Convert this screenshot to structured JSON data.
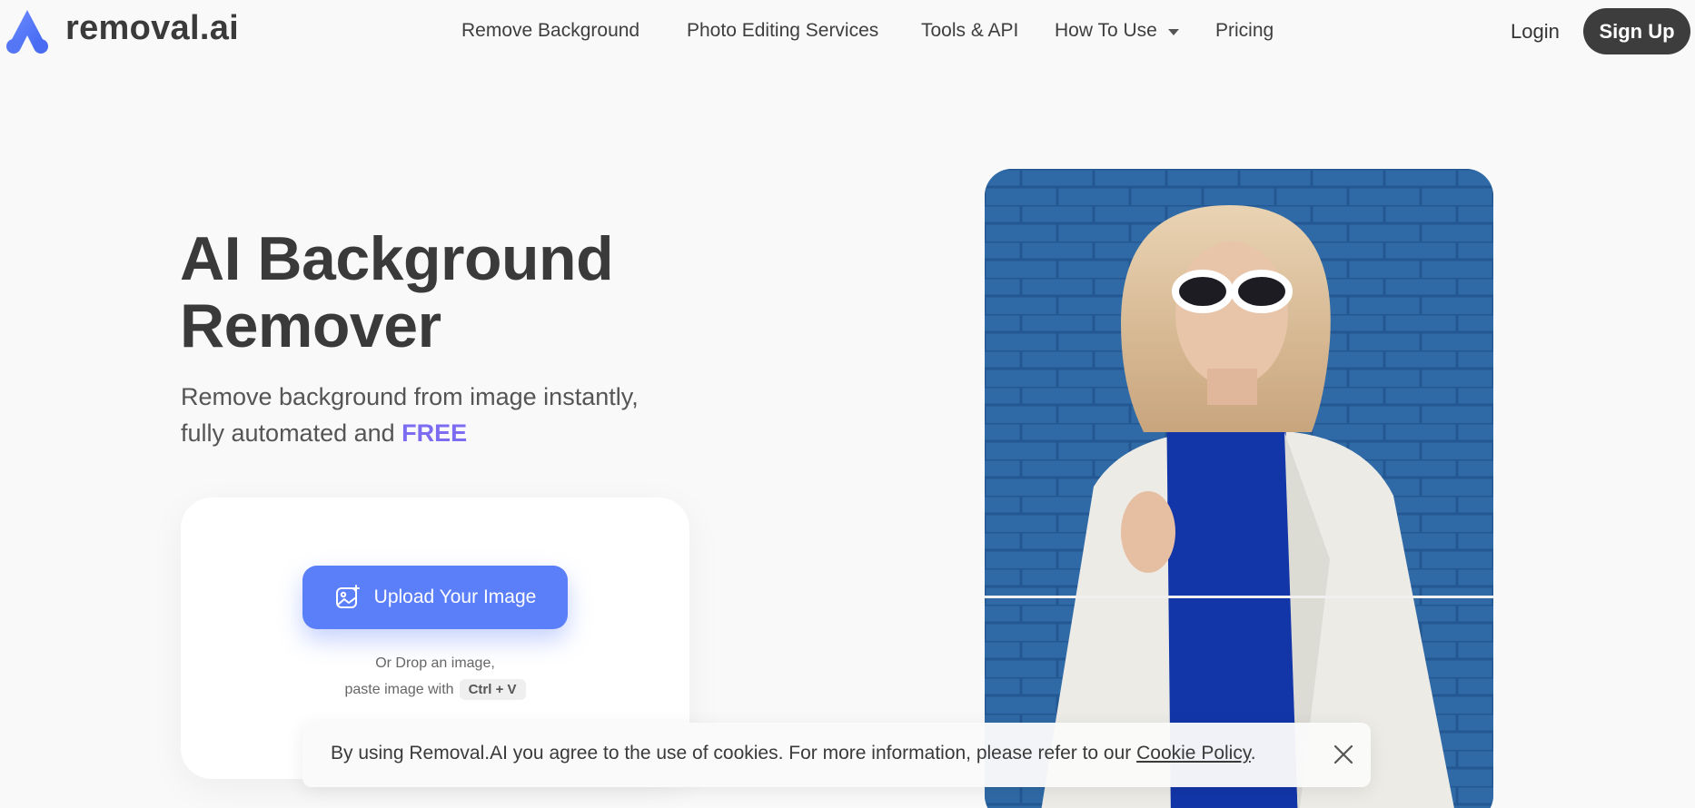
{
  "brand": {
    "name": "removal.ai",
    "accent": "#5b7ef9",
    "free_color": "#7b6cf2"
  },
  "nav": {
    "items": [
      {
        "label": "Remove Background"
      },
      {
        "label": "Photo Editing Services"
      },
      {
        "label": "Tools & API"
      },
      {
        "label": "How To Use",
        "has_dropdown": true
      },
      {
        "label": "Pricing"
      }
    ],
    "login": "Login",
    "signup": "Sign Up"
  },
  "hero": {
    "title_line1": "AI Background",
    "title_line2": "Remover",
    "subtitle_line1": "Remove background from image instantly,",
    "subtitle_line2_prefix": "fully automated and ",
    "subtitle_free": "FREE"
  },
  "upload": {
    "button_label": "Upload Your Image",
    "button_icon": "image-upload-icon",
    "drop_line1": "Or Drop an image,",
    "drop_line2": "paste image with",
    "shortcut": "Ctrl + V"
  },
  "cookie_banner": {
    "text": "By using Removal.AI you agree to the use of cookies. For more information, please refer to our ",
    "link": "Cookie Policy",
    "suffix": ".",
    "close_icon": "close-icon"
  }
}
